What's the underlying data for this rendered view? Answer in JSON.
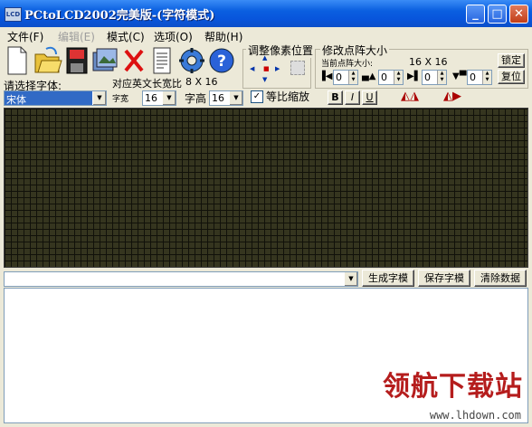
{
  "window": {
    "title": "PCtoLCD2002完美版-(字符模式)",
    "icon_text": "LCD"
  },
  "menu": {
    "file": "文件(F)",
    "edit": "编辑(E)",
    "mode": "模式(C)",
    "options": "选项(O)",
    "help": "帮助(H)"
  },
  "font": {
    "label": "请选择字体:",
    "selected": "宋体",
    "ratio_label": "对应英文长宽比",
    "ratio_value": "8 X 16",
    "width_label": "字宽",
    "width_value": "16",
    "height_label": "字高",
    "height_value": "16",
    "proportional_label": "等比缩放"
  },
  "adjust": {
    "title": "调整像素位置"
  },
  "matrix": {
    "title": "修改点阵大小",
    "current_label": "当前点阵大小:",
    "current_value": "16 X 16",
    "lock_button": "锁定",
    "reset_button": "复位",
    "spin_values": [
      "0",
      "0",
      "0",
      "0"
    ]
  },
  "format": {
    "bold": "B",
    "italic": "I",
    "underline": "U"
  },
  "actions": {
    "generate": "生成字模",
    "save": "保存字模",
    "clear": "清除数据"
  },
  "watermark": {
    "text": "领航下载站",
    "url": "www.lhdown.com"
  },
  "colors": {
    "grid_bg": "#35351f",
    "grid_line": "#11110a",
    "title_blue": "#0a5fe0"
  }
}
